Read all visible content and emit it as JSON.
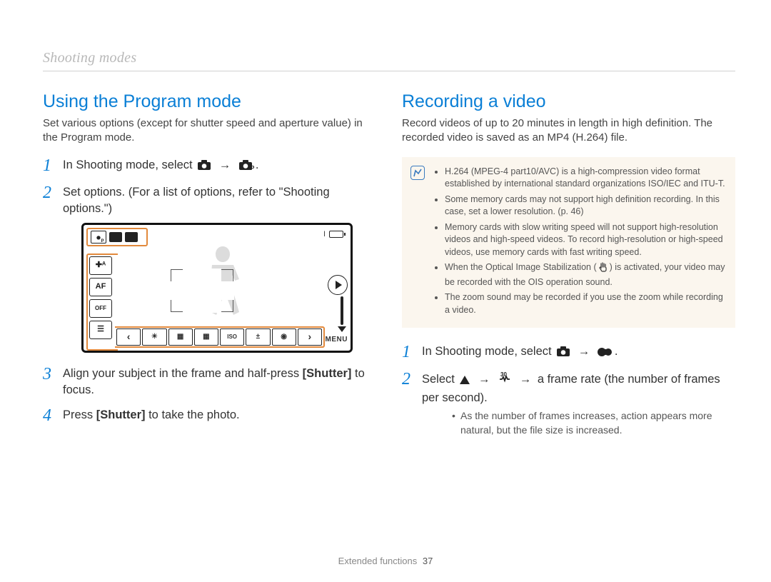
{
  "breadcrumb": "Shooting modes",
  "left": {
    "title": "Using the Program mode",
    "intro": "Set various options (except for shutter speed and aperture value) in the Program mode.",
    "steps": {
      "s1_pre": "In Shooting mode, select ",
      "s2": "Set options. (For a list of options, refer to \"Shooting options.\")",
      "s3_pre": "Align your subject in the frame and half-press ",
      "s3_bold": "[Shutter]",
      "s3_post": " to focus.",
      "s4_pre": "Press ",
      "s4_bold": "[Shutter]",
      "s4_post": " to take the photo."
    },
    "preview": {
      "status_letter": "I",
      "left_btn_1": "✚ᴬ",
      "left_btn_2": "AF",
      "left_btn_3": "OFF",
      "left_btn_4": "☰",
      "bar_prev": "‹",
      "bar_next": "›",
      "bar_i1": "☀",
      "bar_i2": "▦",
      "bar_i3": "▦",
      "bar_i4": "ISO",
      "bar_i5": "±",
      "bar_i6": "◉",
      "menu": "MENU"
    }
  },
  "right": {
    "title": "Recording a video",
    "intro": "Record videos of up to 20 minutes in length in high definition. The recorded video is saved as an MP4 (H.264) file.",
    "note": {
      "b1": "H.264 (MPEG-4 part10/AVC) is a high-compression video format established by international standard organizations ISO/IEC and ITU-T.",
      "b2": "Some memory cards may not support high definition recording. In this case, set a lower resolution. (p. 46)",
      "b3": "Memory cards with slow writing speed will not support high-resolution videos and high-speed videos. To record high-resolution or high-speed videos, use memory cards with fast writing speed.",
      "b4_pre": "When the Optical Image Stabilization (",
      "b4_post": ") is activated, your video may be recorded with the OIS operation sound.",
      "b5": "The zoom sound may be recorded if you use the zoom while recording a video."
    },
    "steps": {
      "s1_pre": "In Shooting mode, select ",
      "s2_pre": "Select ",
      "s2_mid": " a frame rate (the number of frames per second).",
      "sub": "As the number of frames increases, action appears more natural, but the file size is increased."
    }
  },
  "footer": {
    "label": "Extended functions",
    "page": "37"
  },
  "icons": {
    "camera": "camera-icon",
    "camera_p": "camera-p-icon",
    "video": "video-icon",
    "up_triangle": "up-triangle-icon",
    "framerate": "framerate-30-icon",
    "hand": "ois-hand-icon",
    "note": "note-icon"
  }
}
